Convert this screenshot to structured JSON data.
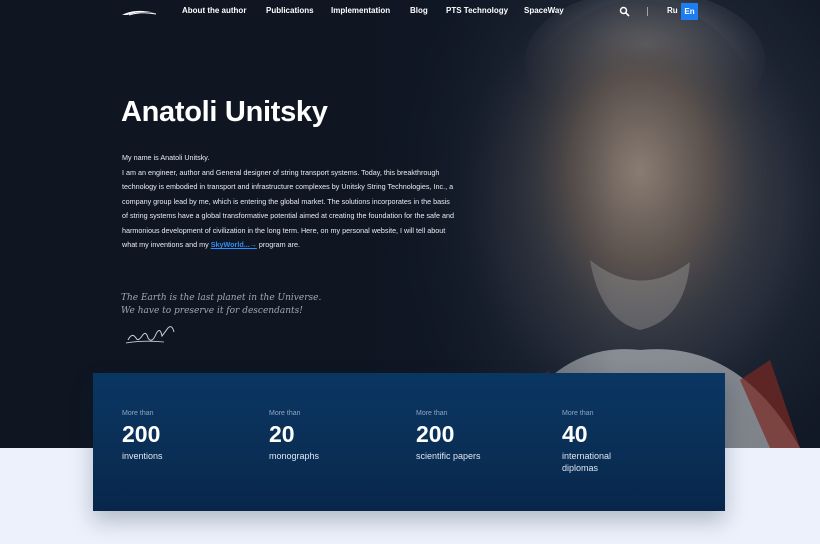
{
  "nav": {
    "items": [
      {
        "label": "About the author"
      },
      {
        "label": "Publications"
      },
      {
        "label": "Implementation"
      },
      {
        "label": "Blog"
      },
      {
        "label": "PTS Technology"
      },
      {
        "label": "SpaceWay"
      }
    ],
    "divider": "|",
    "lang_ru": "Ru",
    "lang_en": "En"
  },
  "hero": {
    "title": "Anatoli Unitsky",
    "intro_line1": "My name is Anatoli Unitsky.",
    "intro_body": "I am an engineer, author and General designer of string transport systems. Today, this breakthrough technology is embodied in transport and infrastructure complexes by Unitsky String Technologies, Inc., a company group lead by me, which is entering the global market. The solutions incorporates in the basis of string systems have a global transformative potential aimed at creating the foundation for the safe and harmonious development of civilization in the long term. Here, on my personal website, I will tell about what my inventions and my",
    "link_text": "SkyWorld...→",
    "intro_tail": " program are.",
    "quote_line1": "The Earth is the last planet in the Universe.",
    "quote_line2": "We have to preserve it for descendants!"
  },
  "stats": [
    {
      "pre": "More than",
      "value": "200",
      "label": "inventions"
    },
    {
      "pre": "More than",
      "value": "20",
      "label": "monographs"
    },
    {
      "pre": "More than",
      "value": "200",
      "label": "scientific papers"
    },
    {
      "pre": "More than",
      "value": "40",
      "label": "international diplomas"
    }
  ],
  "colors": {
    "accent": "#1c7ef0",
    "link": "#2f8df6",
    "stats_bg": "#0a3663"
  }
}
